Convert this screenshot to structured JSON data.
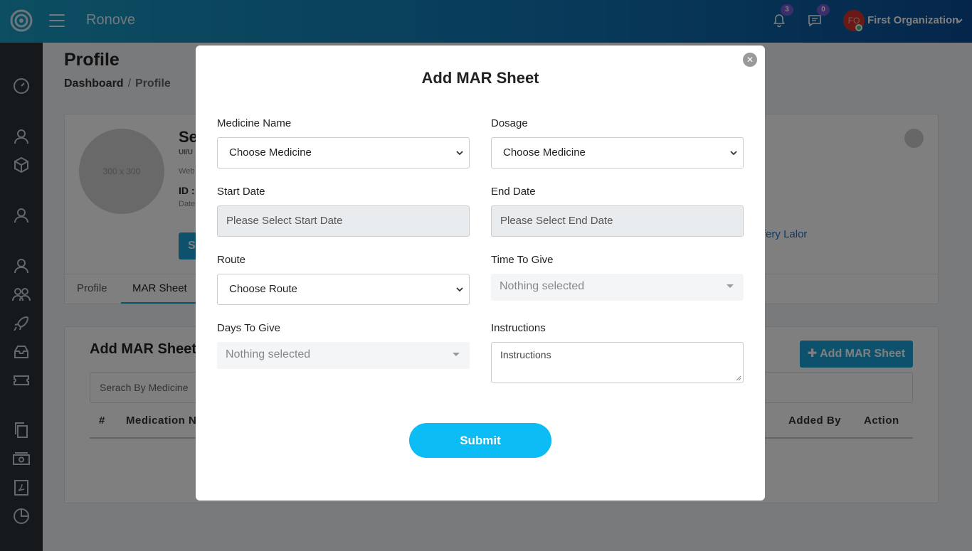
{
  "app": {
    "brand": "Ronove"
  },
  "header": {
    "notifications_count": "3",
    "messages_count": "0",
    "avatar_initials": "FO",
    "org_name": "First Organization"
  },
  "page": {
    "title": "Profile",
    "breadcrumb": {
      "home": "Dashboard",
      "separator": "/",
      "current": "Profile"
    },
    "profile": {
      "image_placeholder": "300 x 300",
      "name": "Se",
      "role": "UI/U",
      "website": "Web",
      "id_label": "ID :",
      "date_label": "Date",
      "button_label": "S",
      "link_text": "ffery Lalor"
    },
    "tabs": [
      {
        "label": "Profile"
      },
      {
        "label": "MAR Sheet"
      }
    ],
    "section": {
      "title": "Add MAR Sheet",
      "add_button": "Add MAR Sheet",
      "search_placeholder": "Serach By Medicine",
      "columns": [
        "#",
        "Medication N",
        "Added By",
        "Action"
      ]
    }
  },
  "modal": {
    "title": "Add MAR Sheet",
    "close_symbol": "✕",
    "fields": {
      "medicine_name": {
        "label": "Medicine Name",
        "value": "Choose Medicine"
      },
      "dosage": {
        "label": "Dosage",
        "value": "Choose Medicine"
      },
      "start_date": {
        "label": "Start Date",
        "placeholder": "Please Select Start Date"
      },
      "end_date": {
        "label": "End Date",
        "placeholder": "Please Select End Date"
      },
      "route": {
        "label": "Route",
        "value": "Choose Route"
      },
      "time_to_give": {
        "label": "Time To Give",
        "value": "Nothing selected"
      },
      "days_to_give": {
        "label": "Days To Give",
        "value": "Nothing selected"
      },
      "instructions": {
        "label": "Instructions",
        "placeholder": "Instructions"
      }
    },
    "submit_label": "Submit"
  },
  "colors": {
    "accent": "#0bbcf5",
    "primary": "#1aa3d9",
    "sidebar": "#2a3336",
    "badge": "#7b5cd6"
  },
  "icons": [
    "logo-icon",
    "menu-icon",
    "bell-icon",
    "chat-icon",
    "chevron-down-icon",
    "dashboard-icon",
    "user-icon",
    "box-icon",
    "users-icon",
    "rocket-icon",
    "inbox-icon",
    "ticket-icon",
    "copy-icon",
    "money-icon",
    "pdf-icon",
    "pie-chart-icon",
    "close-icon",
    "plus-icon"
  ]
}
